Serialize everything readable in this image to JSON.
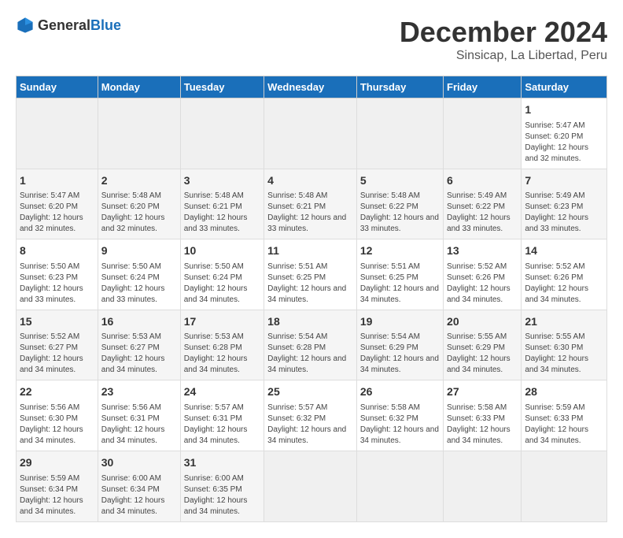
{
  "header": {
    "logo_general": "General",
    "logo_blue": "Blue",
    "title": "December 2024",
    "subtitle": "Sinsicap, La Libertad, Peru"
  },
  "calendar": {
    "days_of_week": [
      "Sunday",
      "Monday",
      "Tuesday",
      "Wednesday",
      "Thursday",
      "Friday",
      "Saturday"
    ],
    "weeks": [
      [
        null,
        null,
        null,
        null,
        null,
        null,
        {
          "day": "1",
          "sunrise": "5:47 AM",
          "sunset": "6:20 PM",
          "daylight": "12 hours and 32 minutes."
        }
      ],
      [
        {
          "day": "1",
          "sunrise": "5:47 AM",
          "sunset": "6:20 PM",
          "daylight": "12 hours and 32 minutes."
        },
        {
          "day": "2",
          "sunrise": "5:48 AM",
          "sunset": "6:20 PM",
          "daylight": "12 hours and 32 minutes."
        },
        {
          "day": "3",
          "sunrise": "5:48 AM",
          "sunset": "6:21 PM",
          "daylight": "12 hours and 33 minutes."
        },
        {
          "day": "4",
          "sunrise": "5:48 AM",
          "sunset": "6:21 PM",
          "daylight": "12 hours and 33 minutes."
        },
        {
          "day": "5",
          "sunrise": "5:48 AM",
          "sunset": "6:22 PM",
          "daylight": "12 hours and 33 minutes."
        },
        {
          "day": "6",
          "sunrise": "5:49 AM",
          "sunset": "6:22 PM",
          "daylight": "12 hours and 33 minutes."
        },
        {
          "day": "7",
          "sunrise": "5:49 AM",
          "sunset": "6:23 PM",
          "daylight": "12 hours and 33 minutes."
        }
      ],
      [
        {
          "day": "8",
          "sunrise": "5:50 AM",
          "sunset": "6:23 PM",
          "daylight": "12 hours and 33 minutes."
        },
        {
          "day": "9",
          "sunrise": "5:50 AM",
          "sunset": "6:24 PM",
          "daylight": "12 hours and 33 minutes."
        },
        {
          "day": "10",
          "sunrise": "5:50 AM",
          "sunset": "6:24 PM",
          "daylight": "12 hours and 34 minutes."
        },
        {
          "day": "11",
          "sunrise": "5:51 AM",
          "sunset": "6:25 PM",
          "daylight": "12 hours and 34 minutes."
        },
        {
          "day": "12",
          "sunrise": "5:51 AM",
          "sunset": "6:25 PM",
          "daylight": "12 hours and 34 minutes."
        },
        {
          "day": "13",
          "sunrise": "5:52 AM",
          "sunset": "6:26 PM",
          "daylight": "12 hours and 34 minutes."
        },
        {
          "day": "14",
          "sunrise": "5:52 AM",
          "sunset": "6:26 PM",
          "daylight": "12 hours and 34 minutes."
        }
      ],
      [
        {
          "day": "15",
          "sunrise": "5:52 AM",
          "sunset": "6:27 PM",
          "daylight": "12 hours and 34 minutes."
        },
        {
          "day": "16",
          "sunrise": "5:53 AM",
          "sunset": "6:27 PM",
          "daylight": "12 hours and 34 minutes."
        },
        {
          "day": "17",
          "sunrise": "5:53 AM",
          "sunset": "6:28 PM",
          "daylight": "12 hours and 34 minutes."
        },
        {
          "day": "18",
          "sunrise": "5:54 AM",
          "sunset": "6:28 PM",
          "daylight": "12 hours and 34 minutes."
        },
        {
          "day": "19",
          "sunrise": "5:54 AM",
          "sunset": "6:29 PM",
          "daylight": "12 hours and 34 minutes."
        },
        {
          "day": "20",
          "sunrise": "5:55 AM",
          "sunset": "6:29 PM",
          "daylight": "12 hours and 34 minutes."
        },
        {
          "day": "21",
          "sunrise": "5:55 AM",
          "sunset": "6:30 PM",
          "daylight": "12 hours and 34 minutes."
        }
      ],
      [
        {
          "day": "22",
          "sunrise": "5:56 AM",
          "sunset": "6:30 PM",
          "daylight": "12 hours and 34 minutes."
        },
        {
          "day": "23",
          "sunrise": "5:56 AM",
          "sunset": "6:31 PM",
          "daylight": "12 hours and 34 minutes."
        },
        {
          "day": "24",
          "sunrise": "5:57 AM",
          "sunset": "6:31 PM",
          "daylight": "12 hours and 34 minutes."
        },
        {
          "day": "25",
          "sunrise": "5:57 AM",
          "sunset": "6:32 PM",
          "daylight": "12 hours and 34 minutes."
        },
        {
          "day": "26",
          "sunrise": "5:58 AM",
          "sunset": "6:32 PM",
          "daylight": "12 hours and 34 minutes."
        },
        {
          "day": "27",
          "sunrise": "5:58 AM",
          "sunset": "6:33 PM",
          "daylight": "12 hours and 34 minutes."
        },
        {
          "day": "28",
          "sunrise": "5:59 AM",
          "sunset": "6:33 PM",
          "daylight": "12 hours and 34 minutes."
        }
      ],
      [
        {
          "day": "29",
          "sunrise": "5:59 AM",
          "sunset": "6:34 PM",
          "daylight": "12 hours and 34 minutes."
        },
        {
          "day": "30",
          "sunrise": "6:00 AM",
          "sunset": "6:34 PM",
          "daylight": "12 hours and 34 minutes."
        },
        {
          "day": "31",
          "sunrise": "6:00 AM",
          "sunset": "6:35 PM",
          "daylight": "12 hours and 34 minutes."
        },
        null,
        null,
        null,
        null
      ]
    ]
  }
}
